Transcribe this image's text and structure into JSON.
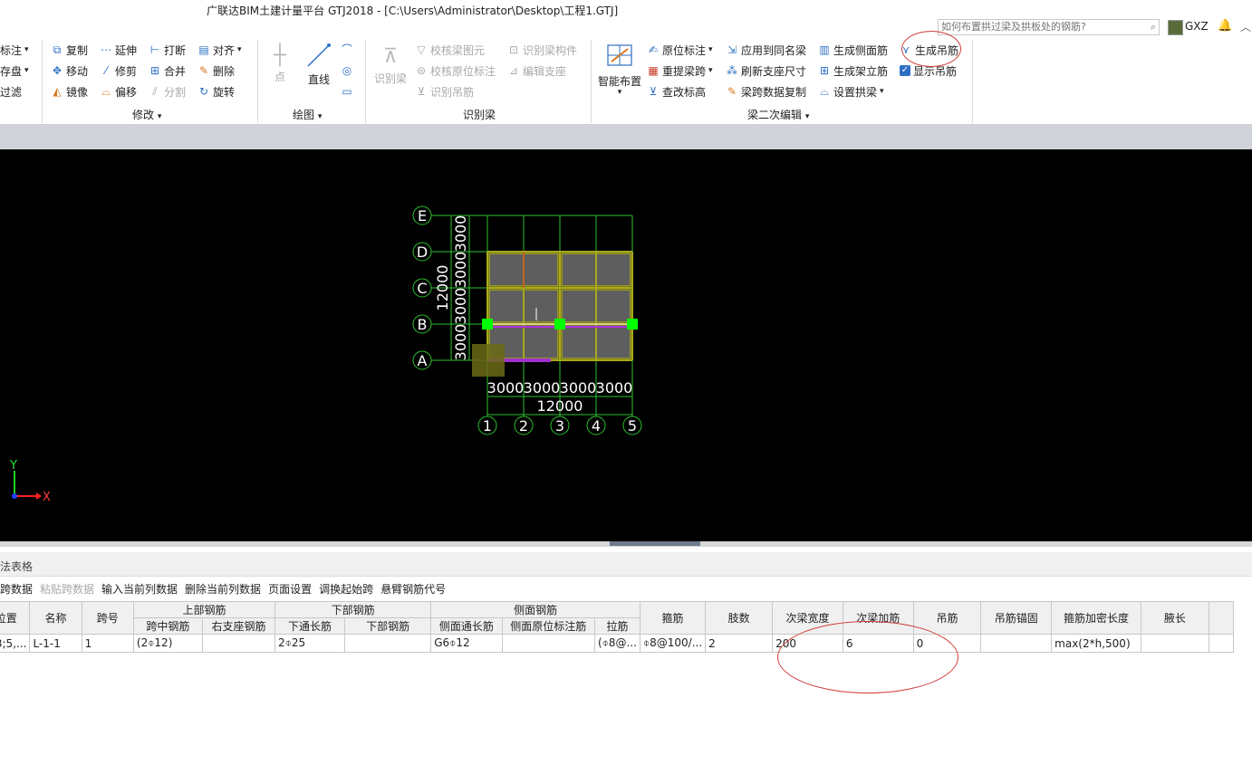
{
  "window": {
    "title": "广联达BIM土建计量平台 GTJ2018 - [C:\\Users\\Administrator\\Desktop\\工程1.GTJ]",
    "search_placeholder": "如何布置拱过梁及拱板处的钢筋?",
    "user": "GXZ"
  },
  "ribbon": {
    "left_partial": [
      "标注",
      "存盘",
      "过滤"
    ],
    "modify": {
      "items": [
        "复制",
        "延伸",
        "打断",
        "对齐",
        "移动",
        "修剪",
        "合并",
        "删除",
        "镜像",
        "偏移",
        "分割",
        "旋转"
      ],
      "label": "修改"
    },
    "draw": {
      "point": "点",
      "line": "直线",
      "label": "绘图"
    },
    "recognize": {
      "big": "识别梁",
      "items": [
        "校核梁图元",
        "识别梁构件",
        "校核原位标注",
        "编辑支座",
        "识别吊筋"
      ],
      "label": "识别梁"
    },
    "secondary": {
      "big": "智能布置",
      "items": [
        "原位标注",
        "应用到同名梁",
        "生成侧面筋",
        "生成吊筋",
        "重提梁跨",
        "刷新支座尺寸",
        "生成架立筋",
        "显示吊筋",
        "查改标高",
        "梁跨数据复制",
        "设置拱梁"
      ],
      "label": "梁二次编辑"
    }
  },
  "canvas": {
    "rows": [
      "E",
      "D",
      "C",
      "B",
      "A"
    ],
    "cols": [
      "1",
      "2",
      "3",
      "4",
      "5"
    ],
    "span_label": "3000",
    "total_label": "12000",
    "axis_x": "X",
    "axis_y": "Y"
  },
  "panel": {
    "title": "法表格",
    "toolbar": [
      "跨数据",
      "粘贴跨数据",
      "输入当前列数据",
      "删除当前列数据",
      "页面设置",
      "调换起始跨",
      "悬臂钢筋代号"
    ],
    "groups": [
      "上部钢筋",
      "下部钢筋",
      "侧面钢筋"
    ],
    "headers": [
      "位置",
      "名称",
      "跨号",
      "跨中钢筋",
      "右支座钢筋",
      "下通长筋",
      "下部钢筋",
      "侧面通长筋",
      "侧面原位标注筋",
      "拉筋",
      "箍筋",
      "肢数",
      "次梁宽度",
      "次梁加筋",
      "吊筋",
      "吊筋锚固",
      "箍筋加密长度",
      "腋长"
    ],
    "row": [
      "3;5,...",
      "L-1-1",
      "1",
      "(2⌽12)",
      "",
      "2⌽25",
      "",
      "G6⌽12",
      "",
      "(⌽8@...",
      "⌽8@100/...",
      "2",
      "200",
      "6",
      "0",
      "",
      "max(2*h,500)",
      ""
    ]
  }
}
